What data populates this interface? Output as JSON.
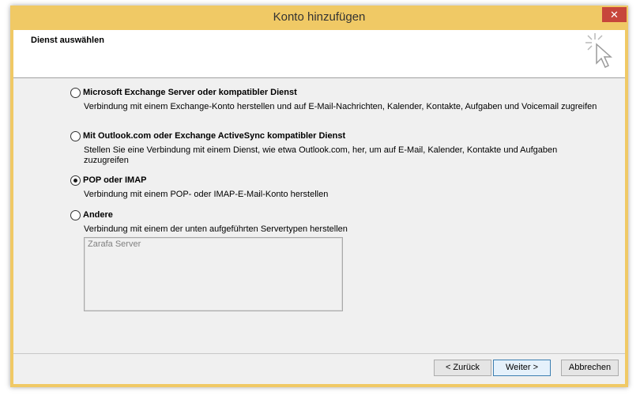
{
  "window": {
    "title": "Konto hinzufügen",
    "close_glyph": "✕"
  },
  "header": {
    "title": "Dienst auswählen",
    "icon": "cursor-sparkle-icon"
  },
  "options": [
    {
      "label": "Microsoft Exchange Server oder kompatibler Dienst",
      "desc": "Verbindung mit einem Exchange-Konto herstellen und auf E-Mail-Nachrichten, Kalender, Kontakte, Aufgaben und Voicemail zugreifen",
      "checked": false
    },
    {
      "label": "Mit Outlook.com oder Exchange ActiveSync kompatibler Dienst",
      "desc": "Stellen Sie eine Verbindung mit einem Dienst, wie etwa Outlook.com, her, um auf E-Mail, Kalender, Kontakte und Aufgaben zuzugreifen",
      "checked": false
    },
    {
      "label": "POP oder IMAP",
      "desc": "Verbindung mit einem POP- oder IMAP-E-Mail-Konto herstellen",
      "checked": true
    },
    {
      "label": "Andere",
      "desc": "Verbindung mit einem der unten aufgeführten Servertypen herstellen",
      "checked": false
    }
  ],
  "server_list": {
    "items": [
      "Zarafa Server"
    ]
  },
  "buttons": {
    "back": "< Zurück",
    "next": "Weiter >",
    "cancel": "Abbrechen"
  },
  "colors": {
    "title_bar": "#f0c965",
    "close": "#c7463b",
    "panel": "#f0f0f0"
  }
}
